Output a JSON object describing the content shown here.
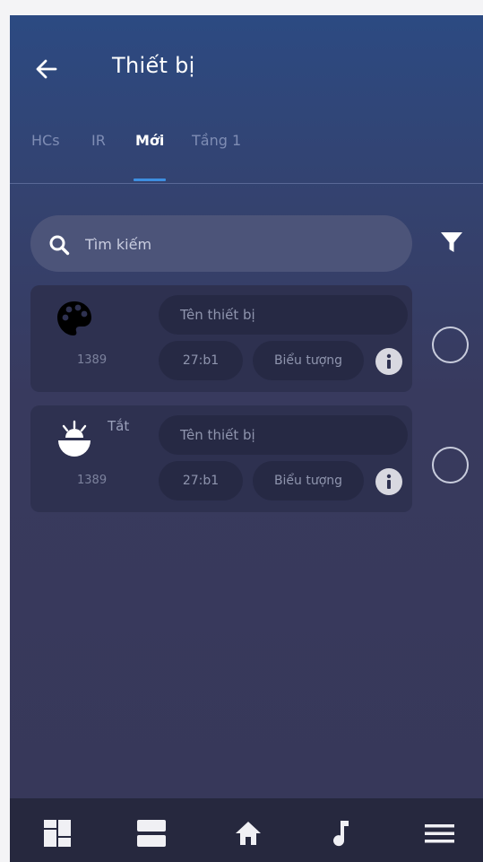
{
  "header": {
    "title": "Thiết bị",
    "tabs": [
      {
        "label": "HCs"
      },
      {
        "label": "IR"
      },
      {
        "label": "Mới"
      },
      {
        "label": "Tầng 1"
      }
    ],
    "active_tab": "Mới"
  },
  "search": {
    "placeholder": "Tìm kiếm"
  },
  "devices": [
    {
      "icon": "palette-icon",
      "status": "",
      "id": "1389",
      "name_placeholder": "Tên thiết bị",
      "address": "27:b1",
      "icon_select_label": "Biểu tượng"
    },
    {
      "icon": "sunrise-bowl-icon",
      "status": "Tắt",
      "id": "1389",
      "name_placeholder": "Tên thiết bị",
      "address": "27:b1",
      "icon_select_label": "Biểu tượng"
    }
  ],
  "bottom_nav": {
    "items": [
      "dashboard-icon",
      "rows-icon",
      "home-icon",
      "music-note-icon",
      "menu-icon"
    ]
  },
  "colors": {
    "accent": "#3d8ee0",
    "header_top": "#2c4a82",
    "background": "#373859",
    "card": "#2e3150",
    "nav": "#26283e"
  }
}
